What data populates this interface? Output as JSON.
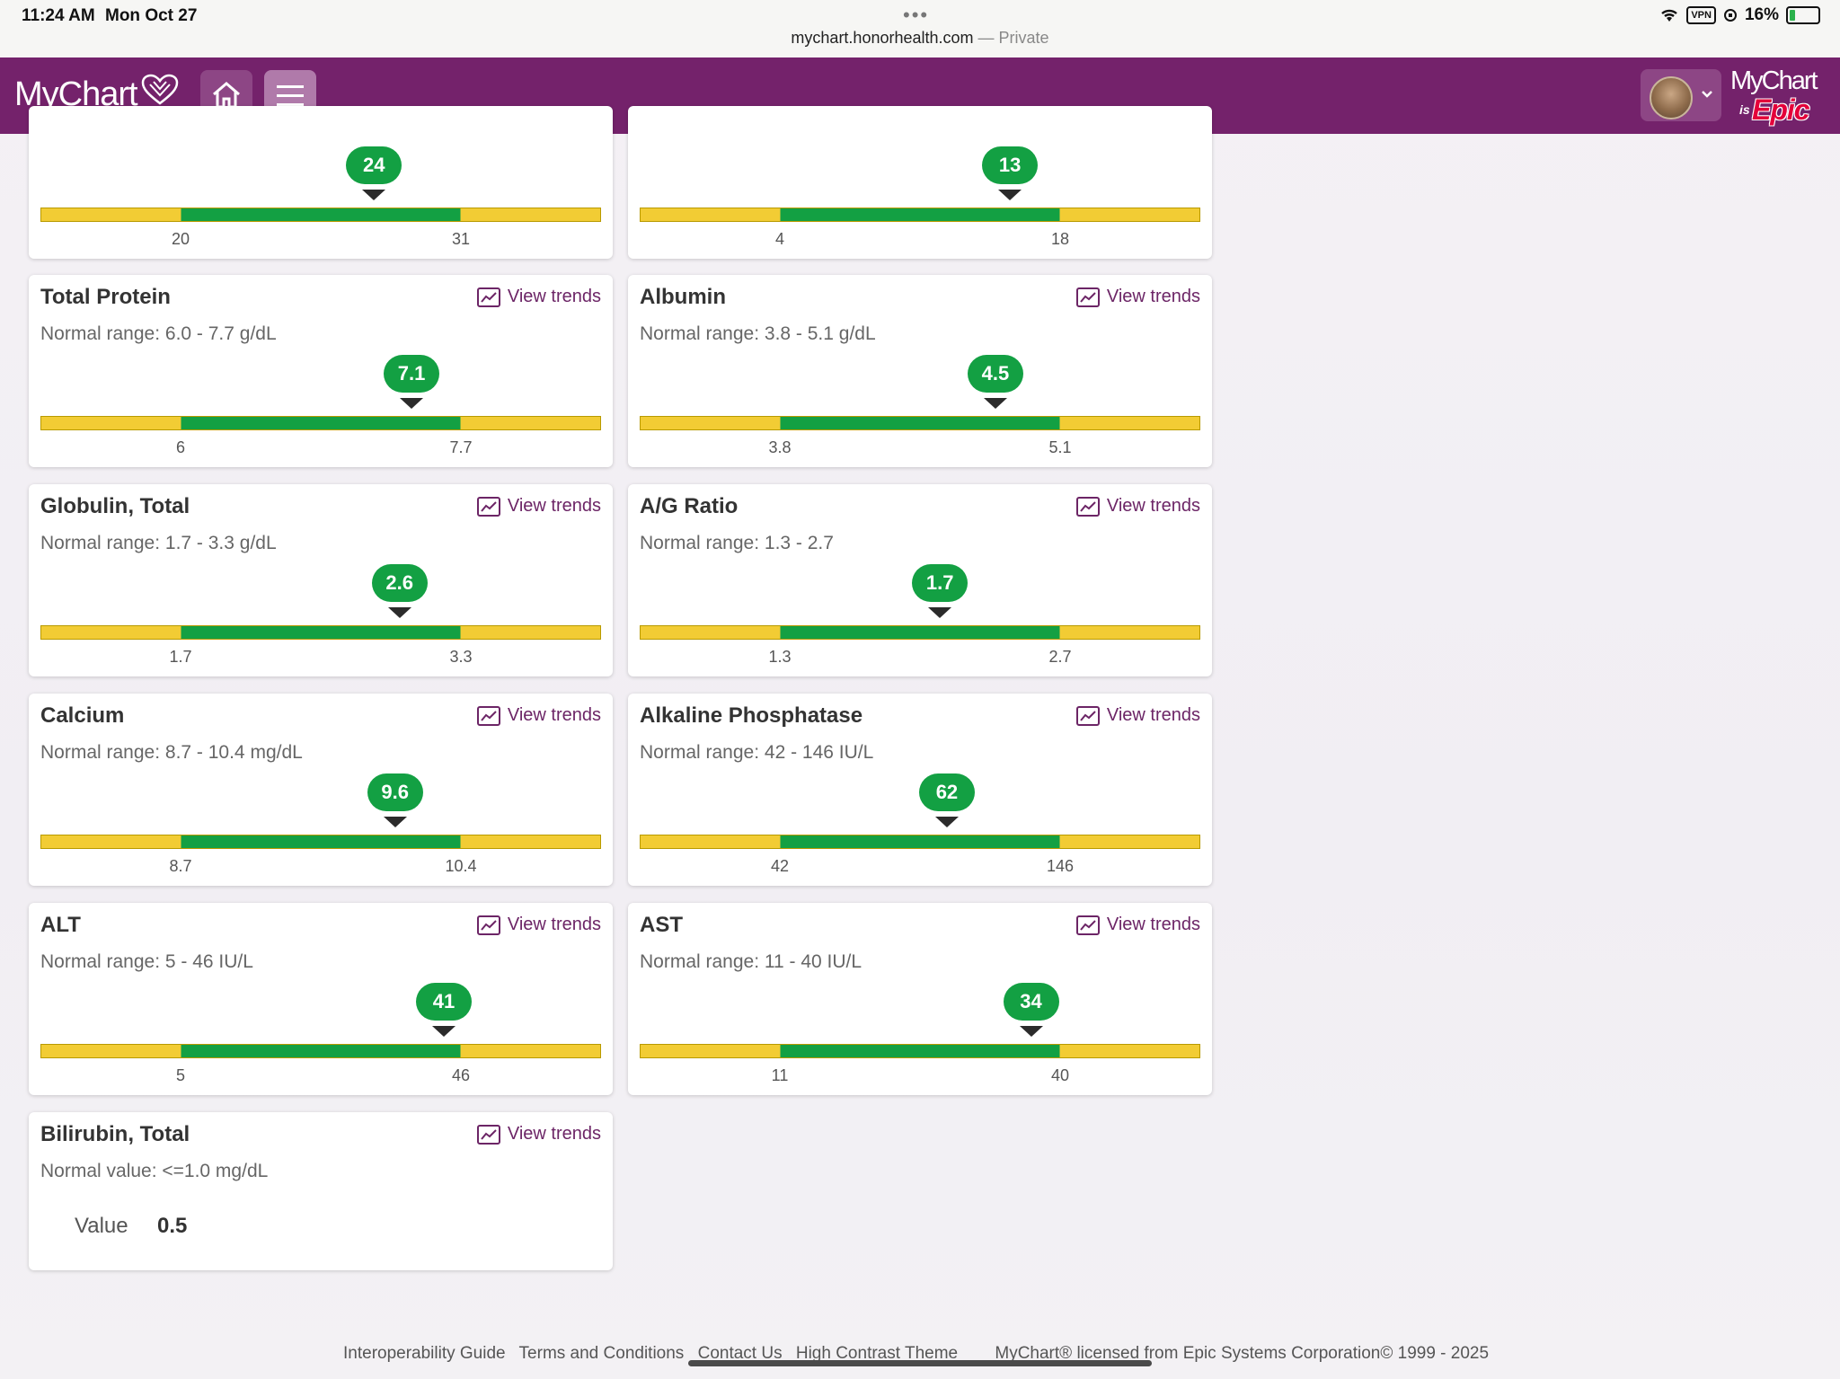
{
  "status_bar": {
    "time": "11:24 AM",
    "date": "Mon Oct 27",
    "url": "mychart.honorhealth.com",
    "privacy": "— Private",
    "vpn": "VPN",
    "battery": "16%"
  },
  "header": {
    "logo_text": "MyChart",
    "brand_mychart": "MyChart",
    "brand_is": "is",
    "brand_epic": "Epic"
  },
  "view_trends_label": "View trends",
  "results": [
    {
      "title": "",
      "range_text": "",
      "value": "24",
      "low": "20",
      "high": "31",
      "pos": 0.69
    },
    {
      "title": "",
      "range_text": "",
      "value": "13",
      "low": "4",
      "high": "18",
      "pos": 0.821
    },
    {
      "title": "Total Protein",
      "range_text": "Normal range: 6.0 - 7.7 g/dL",
      "value": "7.1",
      "low": "6",
      "high": "7.7",
      "pos": 0.824
    },
    {
      "title": "Albumin",
      "range_text": "Normal range: 3.8 - 5.1 g/dL",
      "value": "4.5",
      "low": "3.8",
      "high": "5.1",
      "pos": 0.769
    },
    {
      "title": "Globulin, Total",
      "range_text": "Normal range: 1.7 - 3.3 g/dL",
      "value": "2.6",
      "low": "1.7",
      "high": "3.3",
      "pos": 0.781
    },
    {
      "title": "A/G Ratio",
      "range_text": "Normal range: 1.3 - 2.7",
      "value": "1.7",
      "low": "1.3",
      "high": "2.7",
      "pos": 0.571
    },
    {
      "title": "Calcium",
      "range_text": "Normal range: 8.7 - 10.4 mg/dL",
      "value": "9.6",
      "low": "8.7",
      "high": "10.4",
      "pos": 0.765
    },
    {
      "title": "Alkaline Phosphatase",
      "range_text": "Normal range: 42 - 146 IU/L",
      "value": "62",
      "low": "42",
      "high": "146",
      "pos": 0.596
    },
    {
      "title": "ALT",
      "range_text": "Normal range: 5 - 46 IU/L",
      "value": "41",
      "low": "5",
      "high": "46",
      "pos": 0.939
    },
    {
      "title": "AST",
      "range_text": "Normal range: 11 - 40 IU/L",
      "value": "34",
      "low": "11",
      "high": "40",
      "pos": 0.896
    }
  ],
  "bilirubin": {
    "title": "Bilirubin, Total",
    "range_text": "Normal value: <=1.0 mg/dL",
    "value_label": "Value",
    "value": "0.5"
  },
  "footer": {
    "links": [
      "Interoperability Guide",
      "Terms and Conditions",
      "Contact Us",
      "High Contrast Theme"
    ],
    "copyright": "MyChart® licensed from Epic Systems Corporation© 1999 - 2025"
  }
}
